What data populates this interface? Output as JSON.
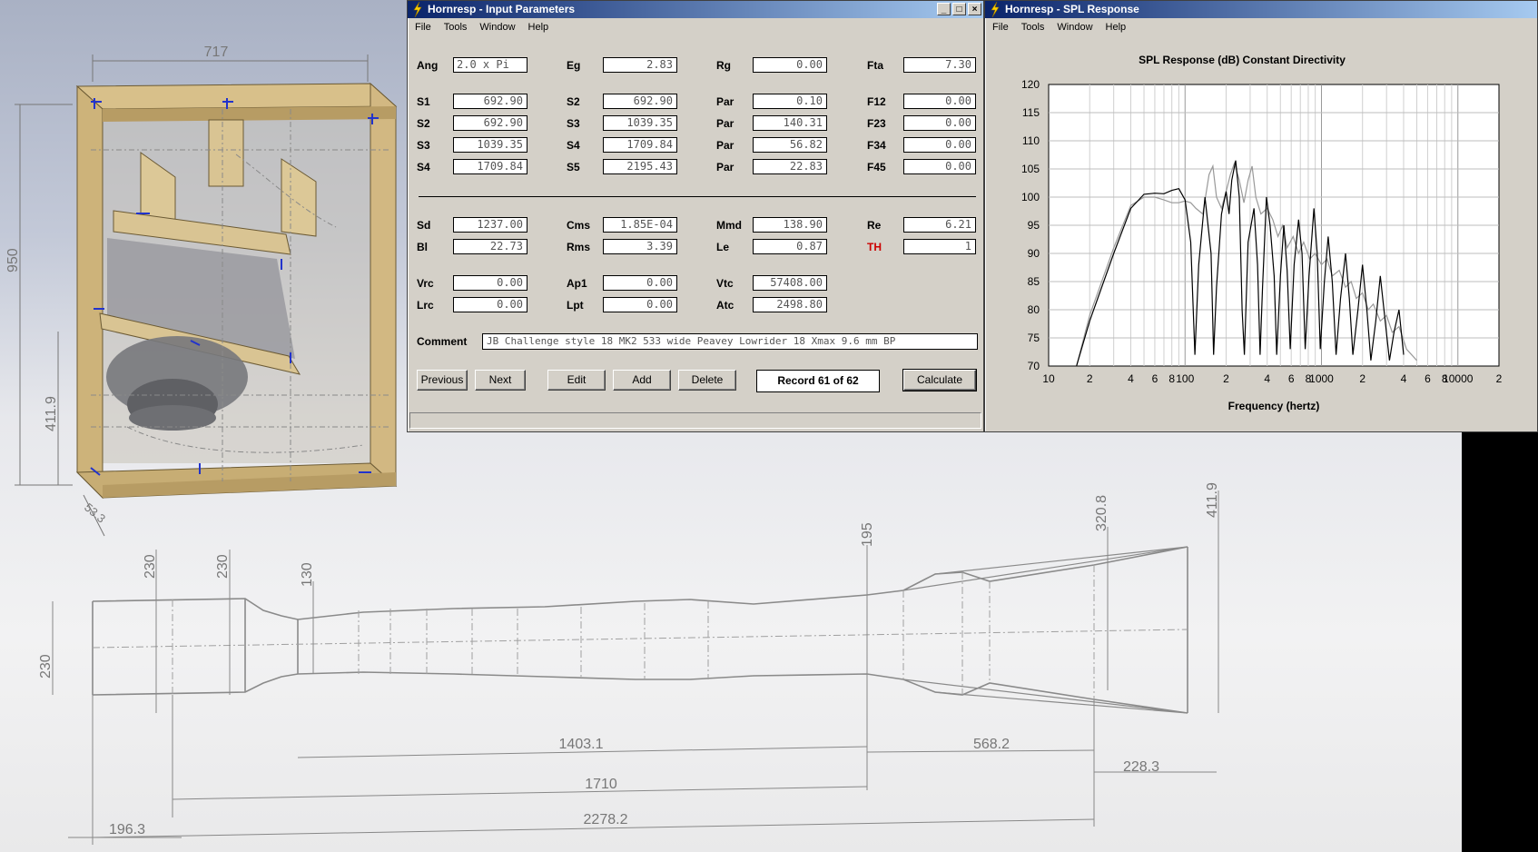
{
  "cad": {
    "dims_top": [
      "717",
      "950",
      "411.9",
      "53.3"
    ],
    "dims_bottom": [
      "230",
      "230",
      "230",
      "130",
      "195",
      "320.8",
      "411.9",
      "1403.1",
      "568.2",
      "1710",
      "228.3",
      "2278.2",
      "196.3"
    ]
  },
  "input_window": {
    "title": "Hornresp - Input Parameters",
    "menu": [
      "File",
      "Tools",
      "Window",
      "Help"
    ],
    "rows1": [
      [
        {
          "l": "Ang",
          "v": "2.0 x Pi"
        },
        {
          "l": "Eg",
          "v": "2.83"
        },
        {
          "l": "Rg",
          "v": "0.00"
        },
        {
          "l": "Fta",
          "v": "7.30"
        }
      ],
      [
        {
          "l": "S1",
          "v": "692.90"
        },
        {
          "l": "S2",
          "v": "692.90"
        },
        {
          "l": "Par",
          "v": "0.10"
        },
        {
          "l": "F12",
          "v": "0.00"
        }
      ],
      [
        {
          "l": "S2",
          "v": "692.90"
        },
        {
          "l": "S3",
          "v": "1039.35"
        },
        {
          "l": "Par",
          "v": "140.31"
        },
        {
          "l": "F23",
          "v": "0.00"
        }
      ],
      [
        {
          "l": "S3",
          "v": "1039.35"
        },
        {
          "l": "S4",
          "v": "1709.84"
        },
        {
          "l": "Par",
          "v": "56.82"
        },
        {
          "l": "F34",
          "v": "0.00"
        }
      ],
      [
        {
          "l": "S4",
          "v": "1709.84"
        },
        {
          "l": "S5",
          "v": "2195.43"
        },
        {
          "l": "Par",
          "v": "22.83"
        },
        {
          "l": "F45",
          "v": "0.00"
        }
      ]
    ],
    "rows2": [
      [
        {
          "l": "Sd",
          "v": "1237.00"
        },
        {
          "l": "Cms",
          "v": "1.85E-04"
        },
        {
          "l": "Mmd",
          "v": "138.90"
        },
        {
          "l": "Re",
          "v": "6.21"
        }
      ],
      [
        {
          "l": "Bl",
          "v": "22.73"
        },
        {
          "l": "Rms",
          "v": "3.39"
        },
        {
          "l": "Le",
          "v": "0.87"
        },
        {
          "l": "TH",
          "v": "1"
        }
      ]
    ],
    "rows3": [
      [
        {
          "l": "Vrc",
          "v": "0.00"
        },
        {
          "l": "Ap1",
          "v": "0.00"
        },
        {
          "l": "Vtc",
          "v": "57408.00"
        }
      ],
      [
        {
          "l": "Lrc",
          "v": "0.00"
        },
        {
          "l": "Lpt",
          "v": "0.00"
        },
        {
          "l": "Atc",
          "v": "2498.80"
        }
      ]
    ],
    "comment_label": "Comment",
    "comment_value": "JB Challenge style 18 MK2  533 wide Peavey Lowrider 18 Xmax 9.6 mm BP",
    "buttons": {
      "previous": "Previous",
      "next": "Next",
      "edit": "Edit",
      "add": "Add",
      "delete": "Delete",
      "calculate": "Calculate"
    },
    "record": "Record 61 of 62",
    "th_color": "#cc0000"
  },
  "spl_window": {
    "title": "Hornresp - SPL Response",
    "menu": [
      "File",
      "Tools",
      "Window",
      "Help"
    ],
    "chart_title": "SPL Response (dB)   Constant Directivity"
  },
  "chart_data": {
    "type": "line",
    "title": "SPL Response (dB)   Constant Directivity",
    "xlabel": "Frequency (hertz)",
    "ylabel": "",
    "x_scale": "log",
    "xlim": [
      10,
      20000
    ],
    "ylim": [
      70,
      120
    ],
    "y_ticks": [
      70,
      75,
      80,
      85,
      90,
      95,
      100,
      105,
      110,
      115,
      120
    ],
    "x_tick_labels": [
      {
        "f": 10,
        "t": "10"
      },
      {
        "f": 20,
        "t": "2"
      },
      {
        "f": 40,
        "t": "4"
      },
      {
        "f": 60,
        "t": "6"
      },
      {
        "f": 80,
        "t": "8"
      },
      {
        "f": 100,
        "t": "100"
      },
      {
        "f": 200,
        "t": "2"
      },
      {
        "f": 400,
        "t": "4"
      },
      {
        "f": 600,
        "t": "6"
      },
      {
        "f": 800,
        "t": "8"
      },
      {
        "f": 1000,
        "t": "1000"
      },
      {
        "f": 2000,
        "t": "2"
      },
      {
        "f": 4000,
        "t": "4"
      },
      {
        "f": 6000,
        "t": "6"
      },
      {
        "f": 8000,
        "t": "8"
      },
      {
        "f": 10000,
        "t": "10000"
      },
      {
        "f": 20000,
        "t": "2"
      }
    ],
    "grid": true,
    "series": [
      {
        "color": "#000000",
        "points": [
          [
            16,
            70
          ],
          [
            20,
            78
          ],
          [
            30,
            90
          ],
          [
            40,
            98
          ],
          [
            50,
            100.5
          ],
          [
            60,
            100.7
          ],
          [
            70,
            100.6
          ],
          [
            80,
            101.2
          ],
          [
            90,
            101.5
          ],
          [
            100,
            99.5
          ],
          [
            110,
            92
          ],
          [
            118,
            72
          ],
          [
            126,
            88
          ],
          [
            140,
            100
          ],
          [
            155,
            90
          ],
          [
            162,
            72
          ],
          [
            170,
            84
          ],
          [
            185,
            97
          ],
          [
            200,
            101
          ],
          [
            210,
            97
          ],
          [
            220,
            103
          ],
          [
            235,
            106.5
          ],
          [
            250,
            100
          ],
          [
            262,
            80
          ],
          [
            272,
            72
          ],
          [
            290,
            92
          ],
          [
            320,
            98
          ],
          [
            340,
            88
          ],
          [
            355,
            72
          ],
          [
            370,
            84
          ],
          [
            395,
            100
          ],
          [
            420,
            95
          ],
          [
            450,
            86
          ],
          [
            470,
            72
          ],
          [
            500,
            86
          ],
          [
            530,
            95
          ],
          [
            560,
            87
          ],
          [
            590,
            73
          ],
          [
            630,
            88
          ],
          [
            680,
            96
          ],
          [
            720,
            90
          ],
          [
            760,
            73
          ],
          [
            810,
            86
          ],
          [
            880,
            98
          ],
          [
            930,
            90
          ],
          [
            980,
            73
          ],
          [
            1050,
            85
          ],
          [
            1120,
            93
          ],
          [
            1200,
            85
          ],
          [
            1280,
            72
          ],
          [
            1380,
            82
          ],
          [
            1500,
            90
          ],
          [
            1600,
            82
          ],
          [
            1700,
            72
          ],
          [
            1850,
            80
          ],
          [
            2000,
            88
          ],
          [
            2150,
            80
          ],
          [
            2300,
            71
          ],
          [
            2500,
            78
          ],
          [
            2700,
            86
          ],
          [
            2900,
            79
          ],
          [
            3150,
            71
          ],
          [
            3400,
            76
          ],
          [
            3700,
            80
          ],
          [
            4000,
            72
          ]
        ]
      },
      {
        "color": "#999999",
        "points": [
          [
            16,
            70
          ],
          [
            20,
            79
          ],
          [
            30,
            91
          ],
          [
            40,
            98.5
          ],
          [
            50,
            100
          ],
          [
            60,
            100
          ],
          [
            70,
            99.5
          ],
          [
            80,
            99
          ],
          [
            90,
            99
          ],
          [
            100,
            99.3
          ],
          [
            110,
            99
          ],
          [
            120,
            98
          ],
          [
            135,
            97
          ],
          [
            150,
            104
          ],
          [
            160,
            105.5
          ],
          [
            170,
            100
          ],
          [
            185,
            98
          ],
          [
            200,
            101
          ],
          [
            215,
            104
          ],
          [
            230,
            106
          ],
          [
            250,
            103
          ],
          [
            270,
            99
          ],
          [
            290,
            103
          ],
          [
            310,
            105.5
          ],
          [
            330,
            100
          ],
          [
            360,
            97
          ],
          [
            400,
            98
          ],
          [
            440,
            96
          ],
          [
            480,
            93
          ],
          [
            520,
            95
          ],
          [
            560,
            91
          ],
          [
            620,
            93
          ],
          [
            680,
            90
          ],
          [
            740,
            92
          ],
          [
            820,
            89
          ],
          [
            900,
            90
          ],
          [
            1000,
            88
          ],
          [
            1100,
            89
          ],
          [
            1200,
            86
          ],
          [
            1350,
            87
          ],
          [
            1500,
            84
          ],
          [
            1650,
            85
          ],
          [
            1800,
            82
          ],
          [
            2000,
            83
          ],
          [
            2200,
            80
          ],
          [
            2400,
            81
          ],
          [
            2700,
            78
          ],
          [
            3000,
            79
          ],
          [
            3300,
            76
          ],
          [
            3700,
            77
          ],
          [
            4200,
            73
          ],
          [
            5000,
            71
          ]
        ]
      }
    ]
  }
}
